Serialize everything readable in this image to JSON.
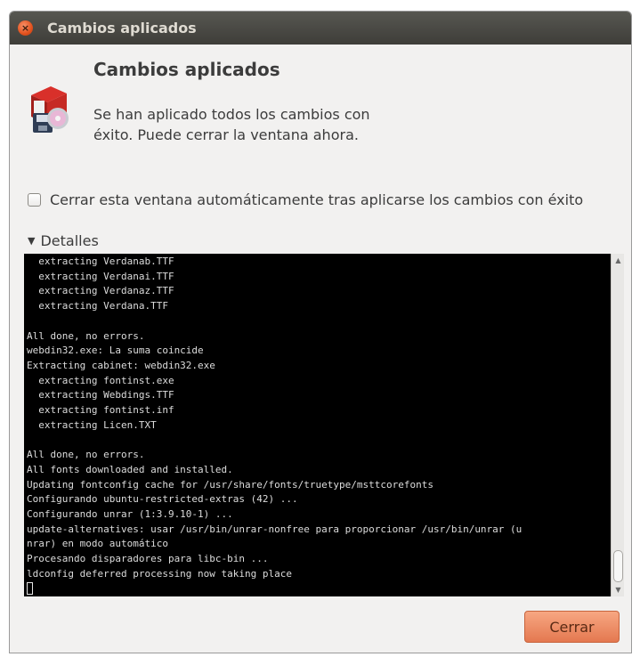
{
  "window": {
    "title": "Cambios aplicados",
    "close_icon_glyph": "×"
  },
  "header": {
    "title": "Cambios aplicados",
    "icon": "software-package-icon"
  },
  "message": "Se han aplicado todos los cambios con éxito. Puede cerrar la ventana ahora.",
  "auto_close": {
    "label": "Cerrar esta ventana automáticamente tras aplicarse los cambios con éxito",
    "checked": false
  },
  "details": {
    "label": "Detalles",
    "expanded": true,
    "arrow": "▼"
  },
  "terminal": {
    "lines": [
      "  extracting Verdanab.TTF",
      "  extracting Verdanai.TTF",
      "  extracting Verdanaz.TTF",
      "  extracting Verdana.TTF",
      "",
      "All done, no errors.",
      "webdin32.exe: La suma coincide",
      "Extracting cabinet: webdin32.exe",
      "  extracting fontinst.exe",
      "  extracting Webdings.TTF",
      "  extracting fontinst.inf",
      "  extracting Licen.TXT",
      "",
      "All done, no errors.",
      "All fonts downloaded and installed.",
      "Updating fontconfig cache for /usr/share/fonts/truetype/msttcorefonts",
      "Configurando ubuntu-restricted-extras (42) ...",
      "Configurando unrar (1:3.9.10-1) ...",
      "update-alternatives: usar /usr/bin/unrar-nonfree para proporcionar /usr/bin/unrar (u",
      "nrar) en modo automático",
      "Procesando disparadores para libc-bin ...",
      "ldconfig deferred processing now taking place"
    ],
    "background": "#000000",
    "foreground": "#dcdcdc"
  },
  "buttons": {
    "close_label": "Cerrar"
  },
  "colors": {
    "titlebar": "#3e3d39",
    "accent": "#e47850",
    "window_bg": "#f2f1f0"
  }
}
